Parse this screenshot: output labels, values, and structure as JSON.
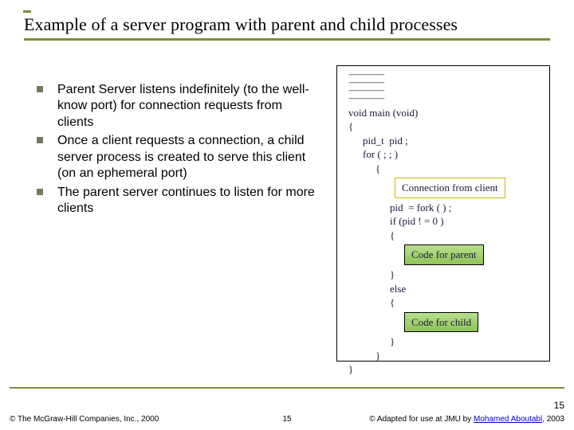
{
  "title": "Example of a server program with parent and child processes",
  "bullets": [
    "Parent Server listens indefinitely (to the well-know port) for connection requests from clients",
    "Once a client requests a connection, a child server process is created to serve this client (on an ephemeral port)",
    "The parent server continues to listen for more clients"
  ],
  "code": {
    "void_main": "void main (void)",
    "open_brace": "{",
    "pid_decl": "pid_t  pid ;",
    "for_loop": "for ( ; ; )",
    "loop_open": "{",
    "conn_box": "Connection from client",
    "pid_fork": "pid  = fork ( ) ;",
    "if_cond": "if (pid ! = 0 )",
    "if_open": "{",
    "parent_box": "Code  for  parent",
    "if_close": "}",
    "else_kw": "else",
    "else_open": "{",
    "child_box": "Code  for child",
    "else_close": "}",
    "loop_close": "}",
    "main_close": "}"
  },
  "footer": {
    "left": "© The McGraw-Hill Companies, Inc., 2000",
    "center": "15",
    "page_above": "15",
    "right_prefix": "© Adapted for use at JMU by ",
    "right_link": "Mohamed Aboutabl",
    "right_suffix": ", 2003"
  }
}
